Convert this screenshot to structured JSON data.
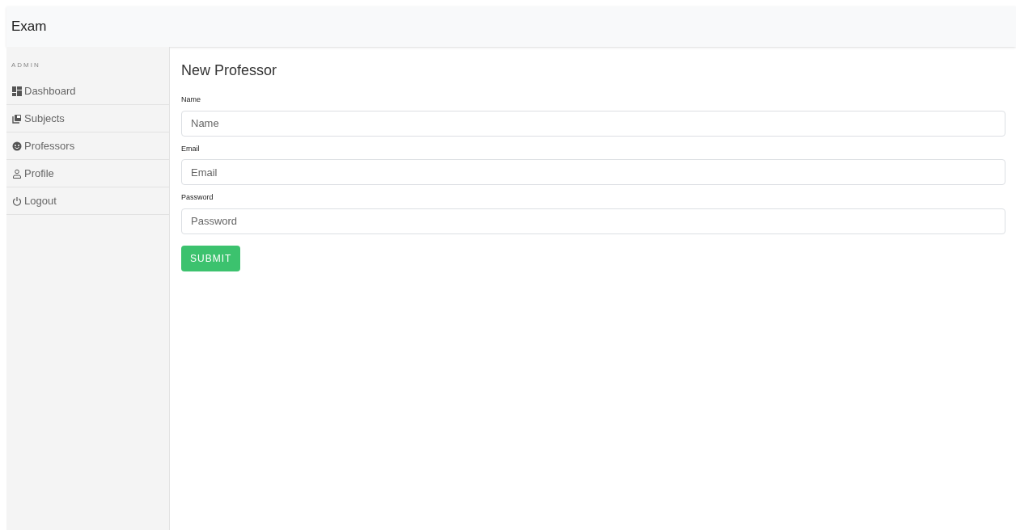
{
  "app_title": "Exam",
  "sidebar": {
    "section": "ADMIN",
    "items": [
      {
        "label": "Dashboard"
      },
      {
        "label": "Subjects"
      },
      {
        "label": "Professors"
      },
      {
        "label": "Profile"
      },
      {
        "label": "Logout"
      }
    ]
  },
  "form": {
    "title": "New Professor",
    "fields": [
      {
        "label": "Name",
        "placeholder": "Name"
      },
      {
        "label": "Email",
        "placeholder": "Email"
      },
      {
        "label": "Password",
        "placeholder": "Password"
      }
    ],
    "submit": "SUBMIT"
  }
}
